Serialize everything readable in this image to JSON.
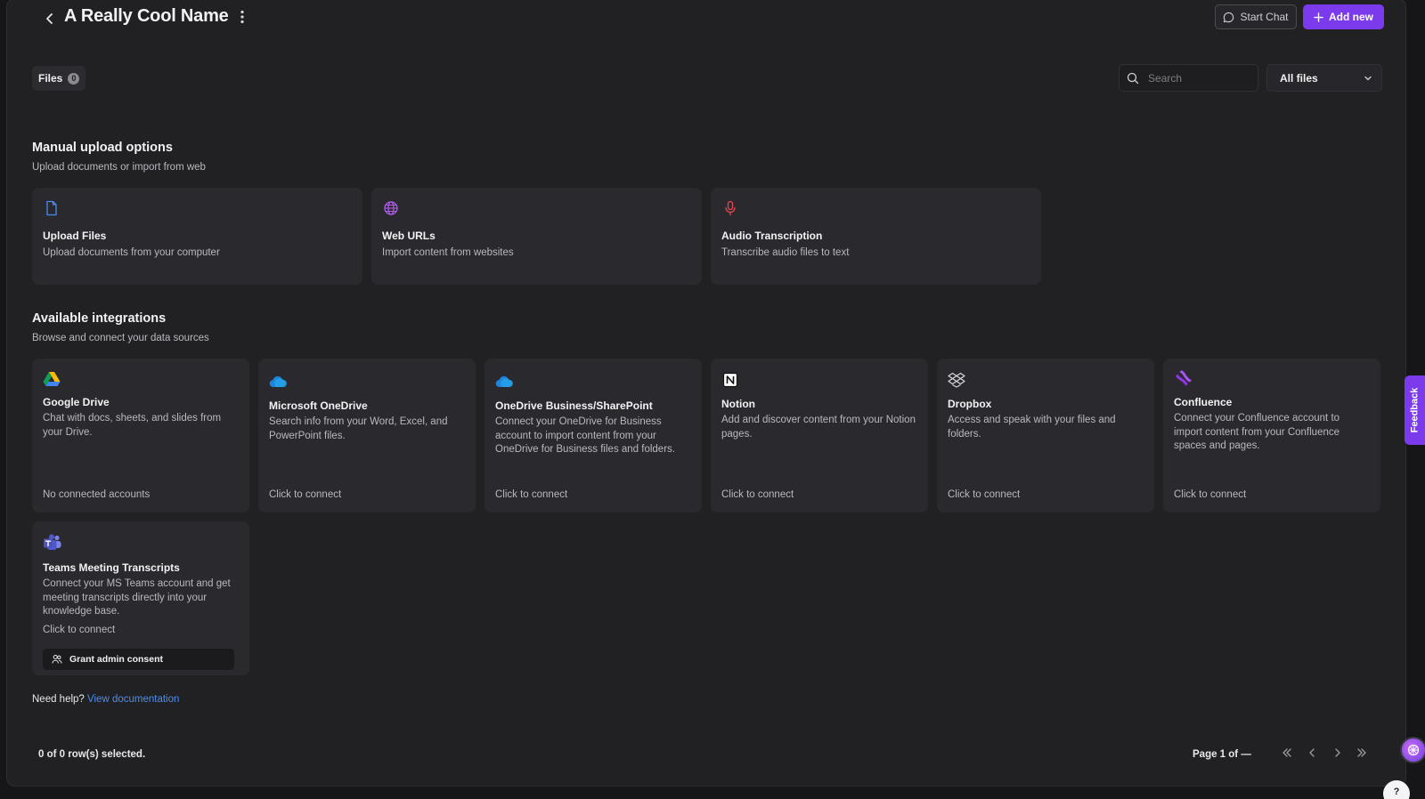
{
  "header": {
    "title": "A Really Cool Name",
    "start_chat_label": "Start Chat",
    "add_new_label": "Add new"
  },
  "toolbar": {
    "files_tab_label": "Files",
    "files_count": "0",
    "search_placeholder": "Search",
    "filter_selected": "All files"
  },
  "manual_upload": {
    "title": "Manual upload options",
    "subtitle": "Upload documents or import from web",
    "cards": [
      {
        "icon": "file-icon",
        "title": "Upload Files",
        "description": "Upload documents from your computer"
      },
      {
        "icon": "globe-icon",
        "title": "Web URLs",
        "description": "Import content from websites"
      },
      {
        "icon": "microphone-icon",
        "title": "Audio Transcription",
        "description": "Transcribe audio files to text"
      }
    ]
  },
  "integrations": {
    "title": "Available integrations",
    "subtitle": "Browse and connect your data sources",
    "cards": [
      {
        "icon": "google-drive-icon",
        "title": "Google Drive",
        "description": "Chat with docs, sheets, and slides from your Drive.",
        "status": "No connected accounts"
      },
      {
        "icon": "onedrive-icon",
        "title": "Microsoft OneDrive",
        "description": "Search info from your Word, Excel, and PowerPoint files.",
        "status": "Click to connect"
      },
      {
        "icon": "onedrive-business-icon",
        "title": "OneDrive Business/SharePoint",
        "description": "Connect your OneDrive for Business account to import content from your OneDrive for Business files and folders.",
        "status": "Click to connect"
      },
      {
        "icon": "notion-icon",
        "title": "Notion",
        "description": "Add and discover content from your Notion pages.",
        "status": "Click to connect"
      },
      {
        "icon": "dropbox-icon",
        "title": "Dropbox",
        "description": "Access and speak with your files and folders.",
        "status": "Click to connect"
      },
      {
        "icon": "confluence-icon",
        "title": "Confluence",
        "description": "Connect your Confluence account to import content from your Confluence spaces and pages.",
        "status": "Click to connect"
      },
      {
        "icon": "teams-icon",
        "title": "Teams Meeting Transcripts",
        "description": "Connect your MS Teams account and get meeting transcripts directly into your knowledge base.",
        "status": "Click to connect",
        "action_label": "Grant admin consent"
      }
    ]
  },
  "help": {
    "prefix": "Need help?",
    "link_label": "View documentation"
  },
  "footer": {
    "rows_selected": "0 of 0 row(s) selected.",
    "page_indicator": "Page 1 of —"
  },
  "feedback_label": "Feedback",
  "help_fab_label": "?",
  "colors": {
    "accent": "#7c3aed",
    "link": "#4a8df0",
    "card_bg": "#2a2a2e",
    "page_bg": "#212124"
  }
}
